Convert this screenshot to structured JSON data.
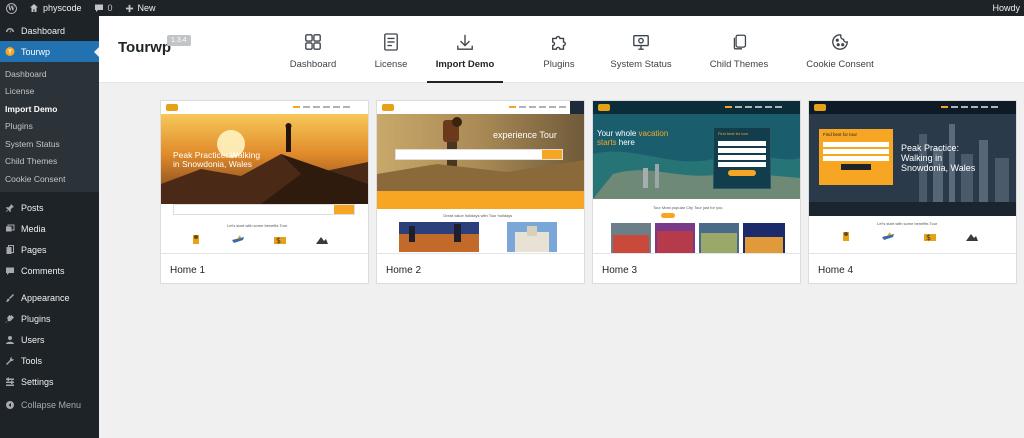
{
  "admin_bar": {
    "site_name": "physcode",
    "comments_count": "0",
    "new_label": "New",
    "howdy": "Howdy"
  },
  "sidebar": {
    "items": [
      {
        "label": "Dashboard",
        "icon": "dashboard-icon"
      },
      {
        "label": "Tourwp",
        "icon": "tourwp-icon",
        "active": true
      },
      {
        "label": "Posts",
        "icon": "pin-icon"
      },
      {
        "label": "Media",
        "icon": "media-icon"
      },
      {
        "label": "Pages",
        "icon": "pages-icon"
      },
      {
        "label": "Comments",
        "icon": "comments-icon"
      },
      {
        "label": "Appearance",
        "icon": "paintbrush-icon"
      },
      {
        "label": "Plugins",
        "icon": "plugin-icon"
      },
      {
        "label": "Users",
        "icon": "users-icon"
      },
      {
        "label": "Tools",
        "icon": "wrench-icon"
      },
      {
        "label": "Settings",
        "icon": "settings-icon"
      }
    ],
    "submenu": [
      "Dashboard",
      "License",
      "Import Demo",
      "Plugins",
      "System Status",
      "Child Themes",
      "Cookie Consent"
    ],
    "submenu_current": "Import Demo",
    "collapse_label": "Collapse Menu"
  },
  "header": {
    "brand": "Tourwp",
    "version": "1.3.4",
    "tabs": [
      {
        "label": "Dashboard",
        "icon": "grid-icon"
      },
      {
        "label": "License",
        "icon": "document-icon"
      },
      {
        "label": "Import Demo",
        "icon": "download-icon",
        "active": true
      },
      {
        "label": "Plugins",
        "icon": "puzzle-icon"
      },
      {
        "label": "System Status",
        "icon": "monitor-icon"
      },
      {
        "label": "Child Themes",
        "icon": "copy-icon"
      },
      {
        "label": "Cookie Consent",
        "icon": "cookie-icon"
      }
    ]
  },
  "demos": [
    {
      "title": "Home 1",
      "hero_text": "Peak Practice: Walking in Snowdonia, Wales",
      "strip_text": "Let's start with some benefits Tour"
    },
    {
      "title": "Home 2",
      "hero_text": "experience Tour",
      "strip_text": "Great value holidays with Tour holidays"
    },
    {
      "title": "Home 3",
      "hero_text_prefix": "Your whole ",
      "hero_text_accent": "vacation starts",
      "hero_text_suffix": " here",
      "form_title": "Find best for tour",
      "strip_text": "Tour Most popular City Tour just for you"
    },
    {
      "title": "Home 4",
      "hero_text": "Peak Practice: Walking in Snowdonia, Wales",
      "form_title": "Find best for tour",
      "strip_text": "Let's start with some benefits Tour"
    }
  ],
  "colors": {
    "admin_dark": "#1d2327",
    "wp_blue": "#2271b1",
    "theme_orange": "#f6a623",
    "teal_dark": "#0b2d3a"
  }
}
